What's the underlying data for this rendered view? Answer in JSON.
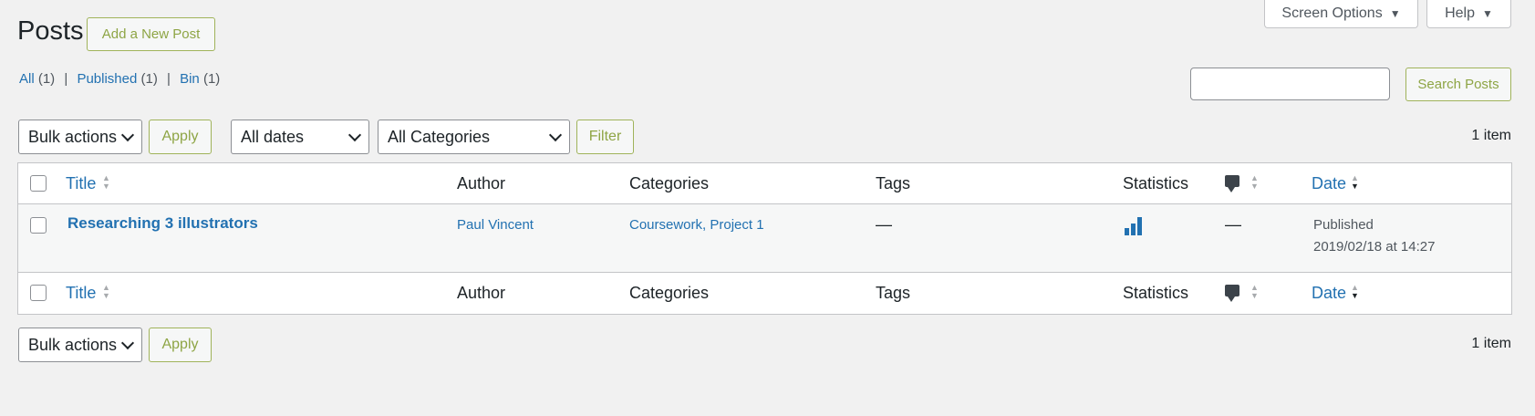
{
  "top_tabs": {
    "screen_options": "Screen Options",
    "help": "Help",
    "arrow": "▼"
  },
  "page": {
    "title": "Posts",
    "add_new": "Add a New Post"
  },
  "views": [
    {
      "label": "All",
      "count": "(1)"
    },
    {
      "label": "Published",
      "count": "(1)"
    },
    {
      "label": "Bin",
      "count": "(1)"
    }
  ],
  "views_separator": "|",
  "search": {
    "placeholder": "",
    "button": "Search Posts"
  },
  "top_nav": {
    "bulk_actions": "Bulk actions",
    "apply": "Apply",
    "dates": "All dates",
    "categories": "All Categories",
    "filter": "Filter",
    "count": "1 item"
  },
  "table": {
    "columns": {
      "title": "Title",
      "author": "Author",
      "categories": "Categories",
      "tags": "Tags",
      "statistics": "Statistics",
      "date": "Date"
    },
    "rows": [
      {
        "title": "Researching 3 illustrators",
        "author": "Paul Vincent",
        "categories": "Coursework, Project 1",
        "tags": "—",
        "comments": "—",
        "status": "Published",
        "date": "2019/02/18 at 14:27"
      }
    ]
  },
  "bottom_nav": {
    "bulk_actions": "Bulk actions",
    "apply": "Apply",
    "count": "1 item"
  },
  "colors": {
    "link": "#2271b1",
    "accent_outline": "#8ea545",
    "background": "#f1f1f1"
  },
  "icons": {
    "sort": "sort-arrows-icon",
    "comments": "comment-bubble-icon",
    "stats": "bar-chart-icon"
  }
}
